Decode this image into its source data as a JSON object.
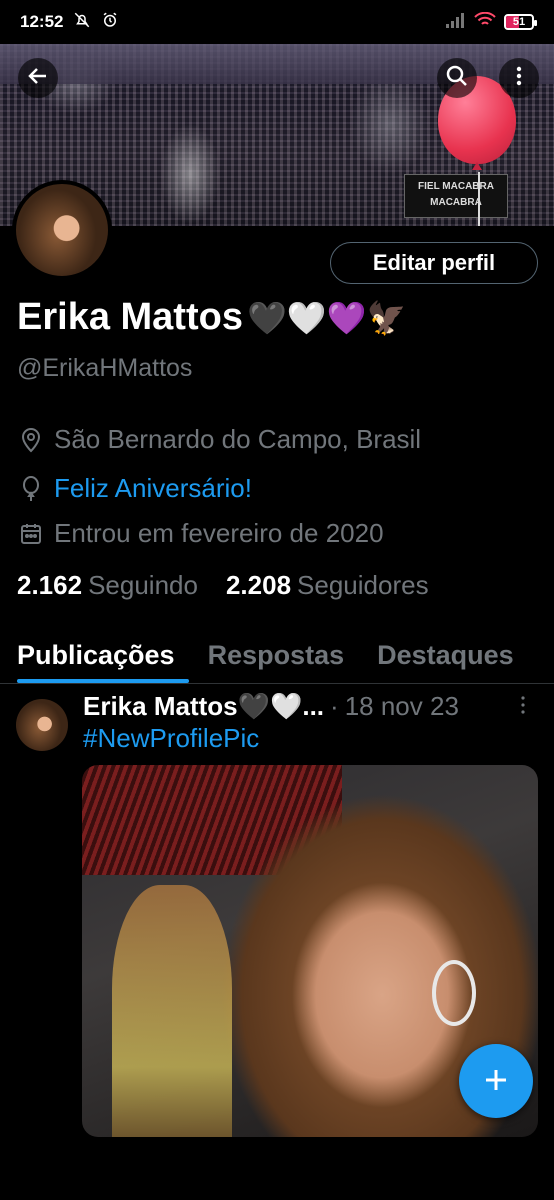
{
  "status_bar": {
    "time": "12:52",
    "battery": "51",
    "battery_level": 0.51,
    "icons": [
      "mute-icon",
      "alarm-icon",
      "signal-icon",
      "wifi-icon",
      "battery-icon"
    ]
  },
  "header": {
    "banner_sign_line1": "FIEL MACABRA",
    "banner_sign_line2": "MACABRA"
  },
  "profile": {
    "edit_button": "Editar perfil",
    "name": "Erika Mattos",
    "name_emojis": "🖤🤍💜🦅",
    "handle": "@ErikaHMattos",
    "location": "São Bernardo do Campo, Brasil",
    "birthday": "Feliz Aniversário!",
    "joined": "Entrou em fevereiro de 2020",
    "following_count": "2.162",
    "following_label": "Seguindo",
    "followers_count": "2.208",
    "followers_label": "Seguidores"
  },
  "tabs": [
    {
      "label": "Publicações",
      "active": true
    },
    {
      "label": "Respostas",
      "active": false
    },
    {
      "label": "Destaques",
      "active": false
    }
  ],
  "post": {
    "author": "Erika Mattos🖤🤍...",
    "separator": "·",
    "date": "18 nov 23",
    "text": "#NewProfilePic"
  },
  "colors": {
    "accent": "#1d9bf0",
    "muted": "#71767b",
    "background": "#000000",
    "balloon": "#e8334f"
  }
}
